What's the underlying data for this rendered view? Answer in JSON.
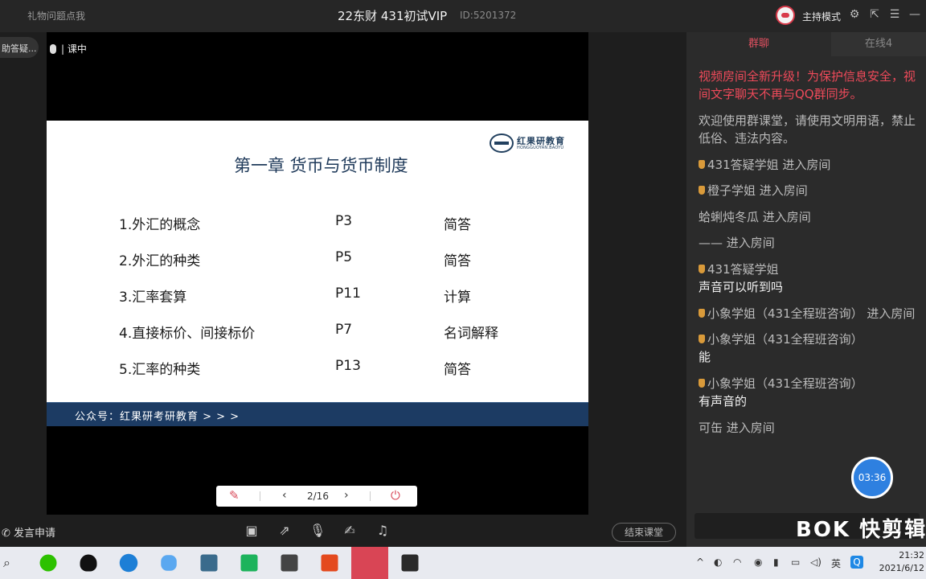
{
  "titlebar": {
    "left_label": "礼物问题点我",
    "room_title": "22东财 431初试VIP",
    "room_id": "ID:5201372",
    "mode_label": "主持模式"
  },
  "left": {
    "qa_pill": "助答疑..."
  },
  "video": {
    "status": "| 课中",
    "slide": {
      "title": "第一章    货币与货币制度",
      "logo_cn": "红果研教育",
      "logo_en": "HONGGUOYAN.BAOYU",
      "rows": [
        {
          "topic": "1.外汇的概念",
          "page": "P3",
          "type": "简答"
        },
        {
          "topic": "2.外汇的种类",
          "page": "P5",
          "type": "简答"
        },
        {
          "topic": "3.汇率套算",
          "page": "P11",
          "type": "计算"
        },
        {
          "topic": "4.直接标价、间接标价",
          "page": "P7",
          "type": "名词解释"
        },
        {
          "topic": "5.汇率的种类",
          "page": "P13",
          "type": "简答"
        }
      ],
      "footer": "公众号：红果研考研教育  > > >"
    },
    "pager": {
      "page": "2/16"
    }
  },
  "bottombar": {
    "apply_label": "发言申请",
    "end_class_label": "结束课堂"
  },
  "chat": {
    "tab_group": "群聊",
    "tab_online": "在线4",
    "notice_1": "视频房间全新升级！为保护信息安全，视",
    "notice_2": "间文字聊天不再与QQ群同步。",
    "welcome_1": "欢迎使用群课堂，请使用文明用语，禁止",
    "welcome_2": "低俗、违法内容。",
    "messages": [
      "431答疑学姐 进入房间",
      "橙子学姐 进入房间",
      "蛤蜊炖冬瓜 进入房间",
      "—— 进入房间",
      "431答疑学姐",
      "声音可以听到吗",
      "小象学姐（431全程班咨询） 进入房间",
      "小象学姐（431全程班咨询）",
      "能",
      "小象学姐（431全程班咨询）",
      "有声音的",
      "可缶 进入房间"
    ],
    "timer": "03:36",
    "watermark": "BOK 快剪辑"
  },
  "taskbar": {
    "time": "21:32",
    "date": "2021/6/12"
  }
}
